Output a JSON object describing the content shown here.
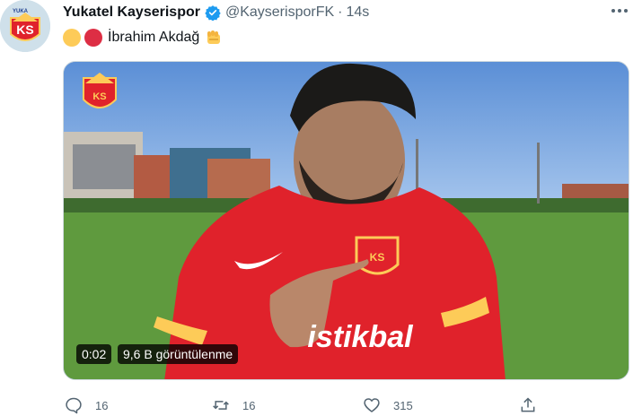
{
  "tweet": {
    "author_name": "Yukatel Kayserispor",
    "author_handle": "@KayserisporFK",
    "separator": "·",
    "time": "14s",
    "text": "İbrahim Akdağ",
    "avatar_logo_text": "KS",
    "avatar_sponsor_text": "YUKA"
  },
  "video": {
    "duration": "0:02",
    "views": "9,6 B görüntülenme",
    "watermark_text": "KS",
    "shirt_sponsor": "istikbal"
  },
  "actions": {
    "reply_count": "16",
    "retweet_count": "16",
    "like_count": "315"
  },
  "colors": {
    "brand_red": "#e0222b",
    "brand_yellow": "#fdcb58",
    "text_primary": "#0f1419",
    "text_secondary": "#536471",
    "verified_blue": "#1d9bf0"
  }
}
